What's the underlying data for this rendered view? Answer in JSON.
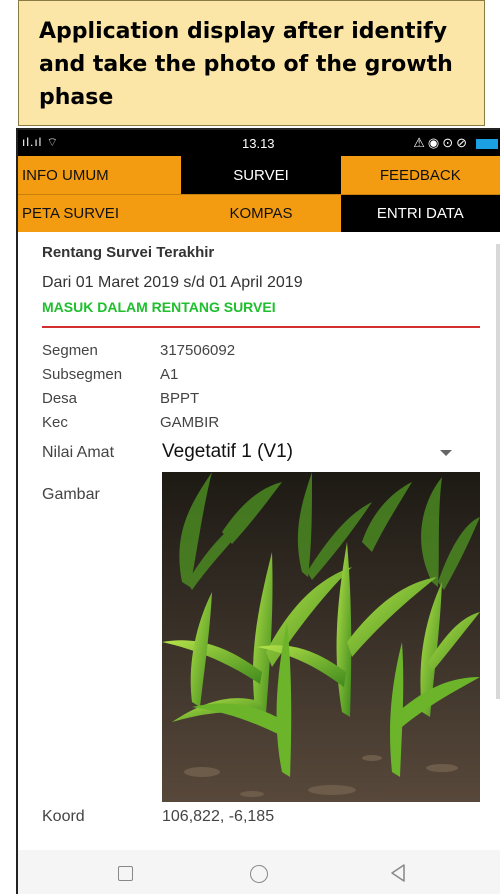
{
  "caption": {
    "line1": "Application display after identify",
    "line2": "and take the photo of the growth",
    "line3": "phase"
  },
  "statusbar": {
    "signal": "ıl.ıl ⌔",
    "time": "13.13",
    "icons": "⚠◉⊙⊘"
  },
  "tabs_top": [
    {
      "label": "INFO UMUM",
      "active": false
    },
    {
      "label": "SURVEI",
      "active": true
    },
    {
      "label": "FEEDBACK",
      "active": false
    }
  ],
  "tabs_sub": [
    {
      "label": "PETA SURVEI",
      "active": false
    },
    {
      "label": "KOMPAS",
      "active": false
    },
    {
      "label": "ENTRI DATA",
      "active": true
    }
  ],
  "survey": {
    "section_title": "Rentang Survei Terakhir",
    "range": "Dari 01 Maret 2019 s/d 01 April 2019",
    "status": "MASUK DALAM RENTANG SURVEI",
    "status_color": "#1fbf2e",
    "divider_color": "#d32f2f"
  },
  "details": [
    {
      "label": "Segmen",
      "value": "317506092"
    },
    {
      "label": "Subsegmen",
      "value": "A1"
    },
    {
      "label": "Desa",
      "value": "BPPT"
    },
    {
      "label": "Kec",
      "value": "GAMBIR"
    }
  ],
  "nilai_amat": {
    "label": "Nilai Amat",
    "value": "Vegetatif 1 (V1)"
  },
  "gambar": {
    "label": "Gambar",
    "image": "young-corn-seedlings-photo"
  },
  "koord": {
    "label": "Koord",
    "value": "106,822, -6,185"
  },
  "colors": {
    "tab_bg": "#f39c12",
    "tab_active_bg": "#000000",
    "caption_bg": "#fbe6a7"
  },
  "navbar": {
    "icons": [
      "recent-apps-icon",
      "home-icon",
      "back-icon"
    ]
  }
}
